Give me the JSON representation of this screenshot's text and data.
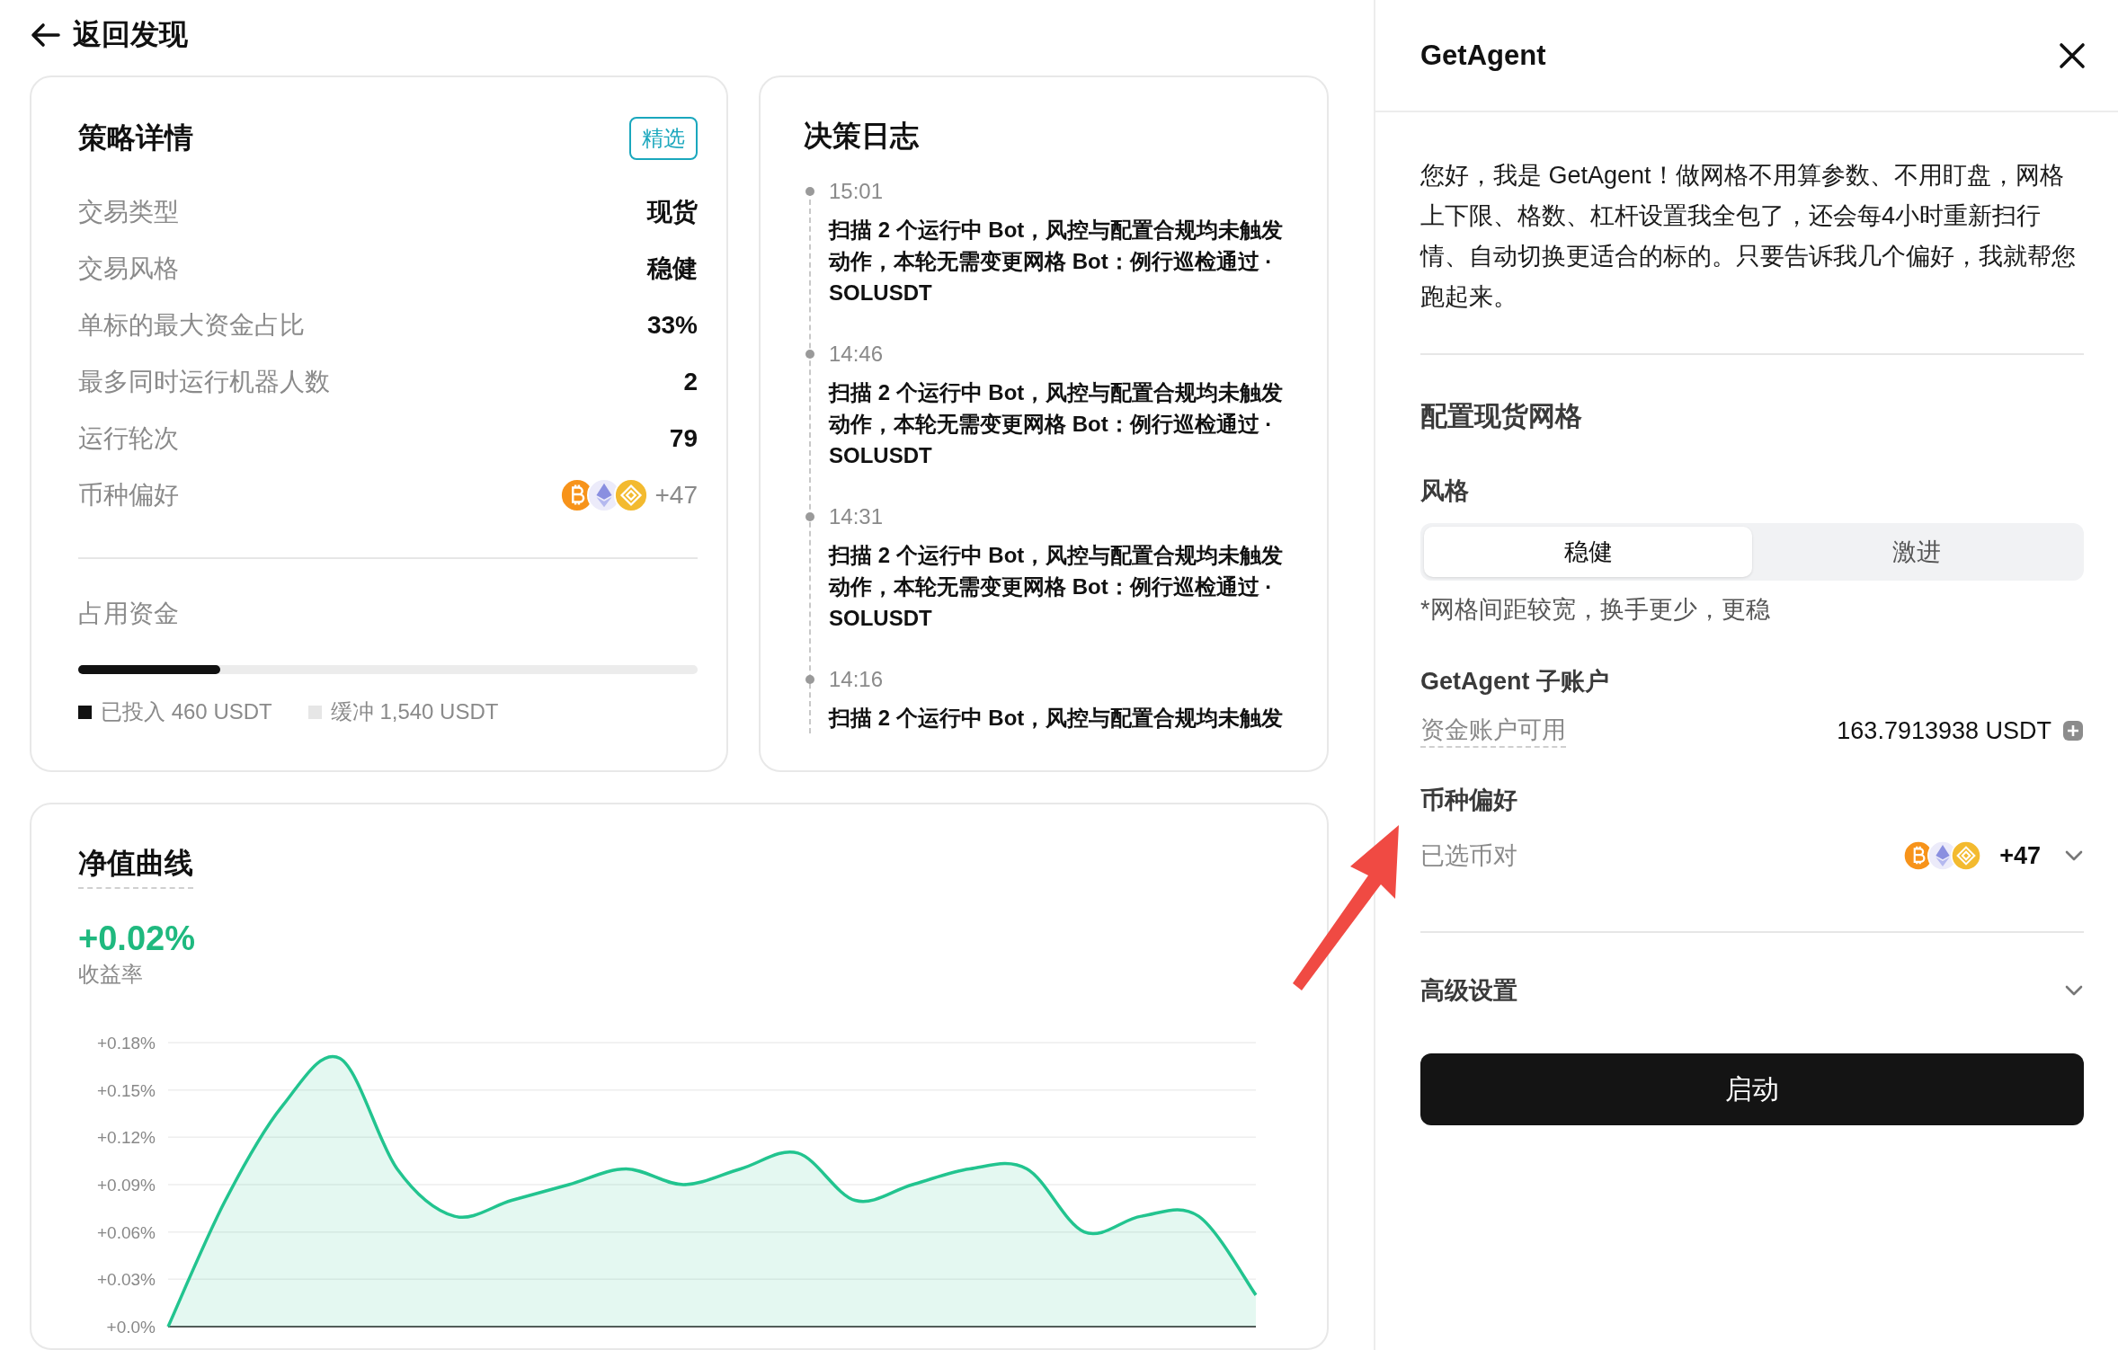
{
  "back_link": {
    "label": "返回发现"
  },
  "strategy": {
    "title": "策略详情",
    "badge": "精选",
    "rows": [
      {
        "kind": "text",
        "label": "交易类型",
        "value": "现货"
      },
      {
        "kind": "text",
        "label": "交易风格",
        "value": "稳健"
      },
      {
        "kind": "text",
        "label": "单标的最大资金占比",
        "value": "33%"
      },
      {
        "kind": "text",
        "label": "最多同时运行机器人数",
        "value": "2"
      },
      {
        "kind": "text",
        "label": "运行轮次",
        "value": "79"
      },
      {
        "kind": "coins",
        "label": "币种偏好",
        "value": "+47"
      }
    ],
    "funds": {
      "title": "占用资金",
      "level": 0.23,
      "legend": [
        {
          "label": "已投入 460 USDT",
          "color": "#111111"
        },
        {
          "label": "缓冲 1,540 USDT",
          "color": "#e6e6e6"
        }
      ]
    }
  },
  "decision_log": {
    "title": "决策日志",
    "entries": [
      {
        "time": "15:01",
        "message": "扫描 2 个运行中 Bot，风控与配置合规均未触发动作，本轮无需变更网格 Bot：例行巡检通过 · SOLUSDT"
      },
      {
        "time": "14:46",
        "message": "扫描 2 个运行中 Bot，风控与配置合规均未触发动作，本轮无需变更网格 Bot：例行巡检通过 · SOLUSDT"
      },
      {
        "time": "14:31",
        "message": "扫描 2 个运行中 Bot，风控与配置合规均未触发动作，本轮无需变更网格 Bot：例行巡检通过 · SOLUSDT"
      },
      {
        "time": "14:16",
        "message": "扫描 2 个运行中 Bot，风控与配置合规均未触发"
      }
    ]
  },
  "nav_curve": {
    "title": "净值曲线",
    "return": "+0.02%",
    "return_label": "收益率",
    "chart_data": {
      "type": "area",
      "ylim": [
        0,
        0.18
      ],
      "grid": true,
      "yticks": [
        {
          "value": 0,
          "label": "+0.0%"
        },
        {
          "value": 0.03,
          "label": "+0.03%"
        },
        {
          "value": 0.06,
          "label": "+0.06%"
        },
        {
          "value": 0.09,
          "label": "+0.09%"
        },
        {
          "value": 0.12,
          "label": "+0.12%"
        },
        {
          "value": 0.15,
          "label": "+0.15%"
        },
        {
          "value": 0.18,
          "label": "+0.18%"
        }
      ],
      "series": [
        {
          "color": "#22c48f",
          "values": [
            0,
            0.08,
            0.14,
            0.17,
            0.1,
            0.07,
            0.08,
            0.09,
            0.1,
            0.09,
            0.1,
            0.11,
            0.08,
            0.09,
            0.1,
            0.1,
            0.06,
            0.07,
            0.07,
            0.02
          ]
        }
      ]
    }
  },
  "panel": {
    "title": "GetAgent",
    "intro": "您好，我是 GetAgent！做网格不用算参数、不用盯盘，网格上下限、格数、杠杆设置我全包了，还会每4小时重新扫行情、自动切换更适合的标的。只要告诉我几个偏好，我就帮您跑起来。",
    "section_title": "配置现货网格",
    "style_label": "风格",
    "style_options": [
      {
        "label": "稳健",
        "selected": true
      },
      {
        "label": "激进",
        "selected": false
      }
    ],
    "style_hint": "*网格间距较宽，换手更少，更稳",
    "account_label": "GetAgent 子账户",
    "available_label": "资金账户可用",
    "available_value": "163.7913938 USDT",
    "coins_label": "币种偏好",
    "pairs_label": "已选币对",
    "pairs_extra": "+47",
    "advanced_label": "高级设置",
    "start_button": "启动"
  }
}
